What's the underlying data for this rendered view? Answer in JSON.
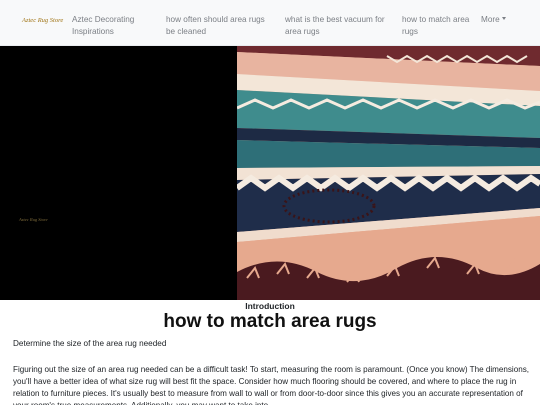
{
  "navbar": {
    "brand": "Aztec Rug Store",
    "items": [
      "Aztec Decorating Inspirations",
      "how often should area rugs be cleaned",
      "what is the best vacuum for area rugs",
      "how to match area rugs"
    ],
    "more_label": "More"
  },
  "hero": {
    "logo_text": "Aztec Rug Store",
    "image_icon": "aztec-rug-photo"
  },
  "article": {
    "section_label": "Introduction",
    "title": "how to match area rugs",
    "subheading": "Determine the size of the area rug needed",
    "paragraph": "Figuring out the size of an area rug needed can be a difficult task! To start, measuring the room is paramount. (Once you know) The dimensions, you'll have a better idea of what size rug will best fit the space. Consider how much flooring should be covered, and where to place the rug in relation to furniture pieces. It's usually best to measure from wall to wall or from door-to-door since this gives you an accurate representation of your room's true measurements. Additionally, you may want to take into"
  },
  "colors": {
    "navbar_bg": "#f8f9fa",
    "brand": "#a07415",
    "nav_text": "#7b7f85",
    "hero_left": "#000000",
    "rug_teal": "#3f8c8d",
    "rug_navy": "#1f2d4a",
    "rug_peach": "#e6a98e",
    "rug_maroon": "#4a1a1f"
  }
}
